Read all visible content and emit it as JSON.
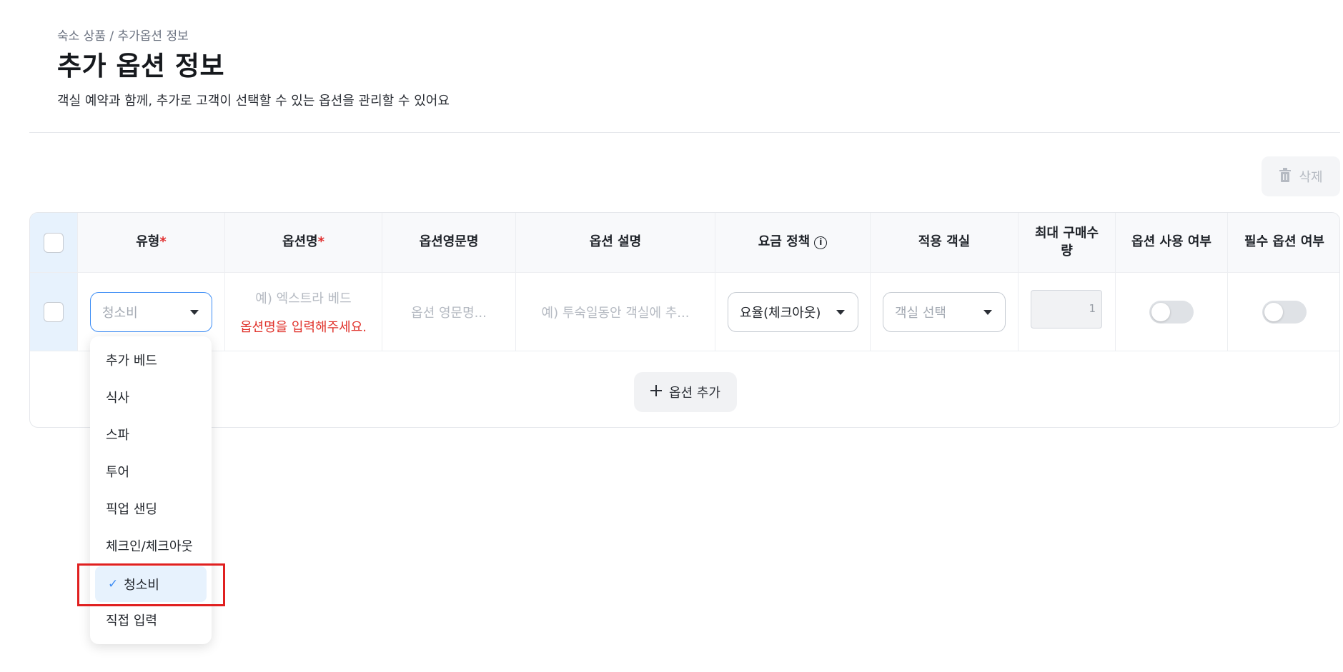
{
  "breadcrumb": "숙소 상품 / 추가옵션 정보",
  "page": {
    "title": "추가 옵션 정보",
    "description": "객실 예약과 함께, 추가로 고객이 선택할 수 있는 옵션을 관리할 수 있어요"
  },
  "toolbar": {
    "delete_label": "삭제"
  },
  "table": {
    "headers": {
      "type": "유형",
      "name": "옵션명",
      "en_name": "옵션영문명",
      "desc": "옵션 설명",
      "pricing": "요금 정책",
      "rooms": "적용 객실",
      "max_qty": "최대 구매수량",
      "use": "옵션 사용 여부",
      "required": "필수 옵션 여부"
    },
    "required_mark": "*",
    "row": {
      "type_value": "청소비",
      "name_placeholder": "예) 엑스트라 베드",
      "name_error": "옵션명을 입력해주세요.",
      "en_name_placeholder": "옵션 영문명...",
      "desc_placeholder": "예) 투숙일동안 객실에 추...",
      "pricing_value": "요율(체크아웃)",
      "rooms_placeholder": "객실 선택",
      "max_qty_value": "1"
    },
    "add_label": "옵션 추가"
  },
  "dropdown": {
    "items": [
      "추가 베드",
      "식사",
      "스파",
      "투어",
      "픽업 샌딩",
      "체크인/체크아웃",
      "청소비",
      "직접 입력"
    ],
    "selected": "청소비"
  },
  "icons": {
    "delete": "trash-icon",
    "info": "info-icon",
    "add": "plus-icon",
    "check": "check-icon",
    "caret": "caret-down-icon"
  },
  "colors": {
    "accent": "#3d8df5",
    "error": "#e0322b",
    "selected_bg": "#e7f2fd",
    "highlight": "#e02020"
  }
}
